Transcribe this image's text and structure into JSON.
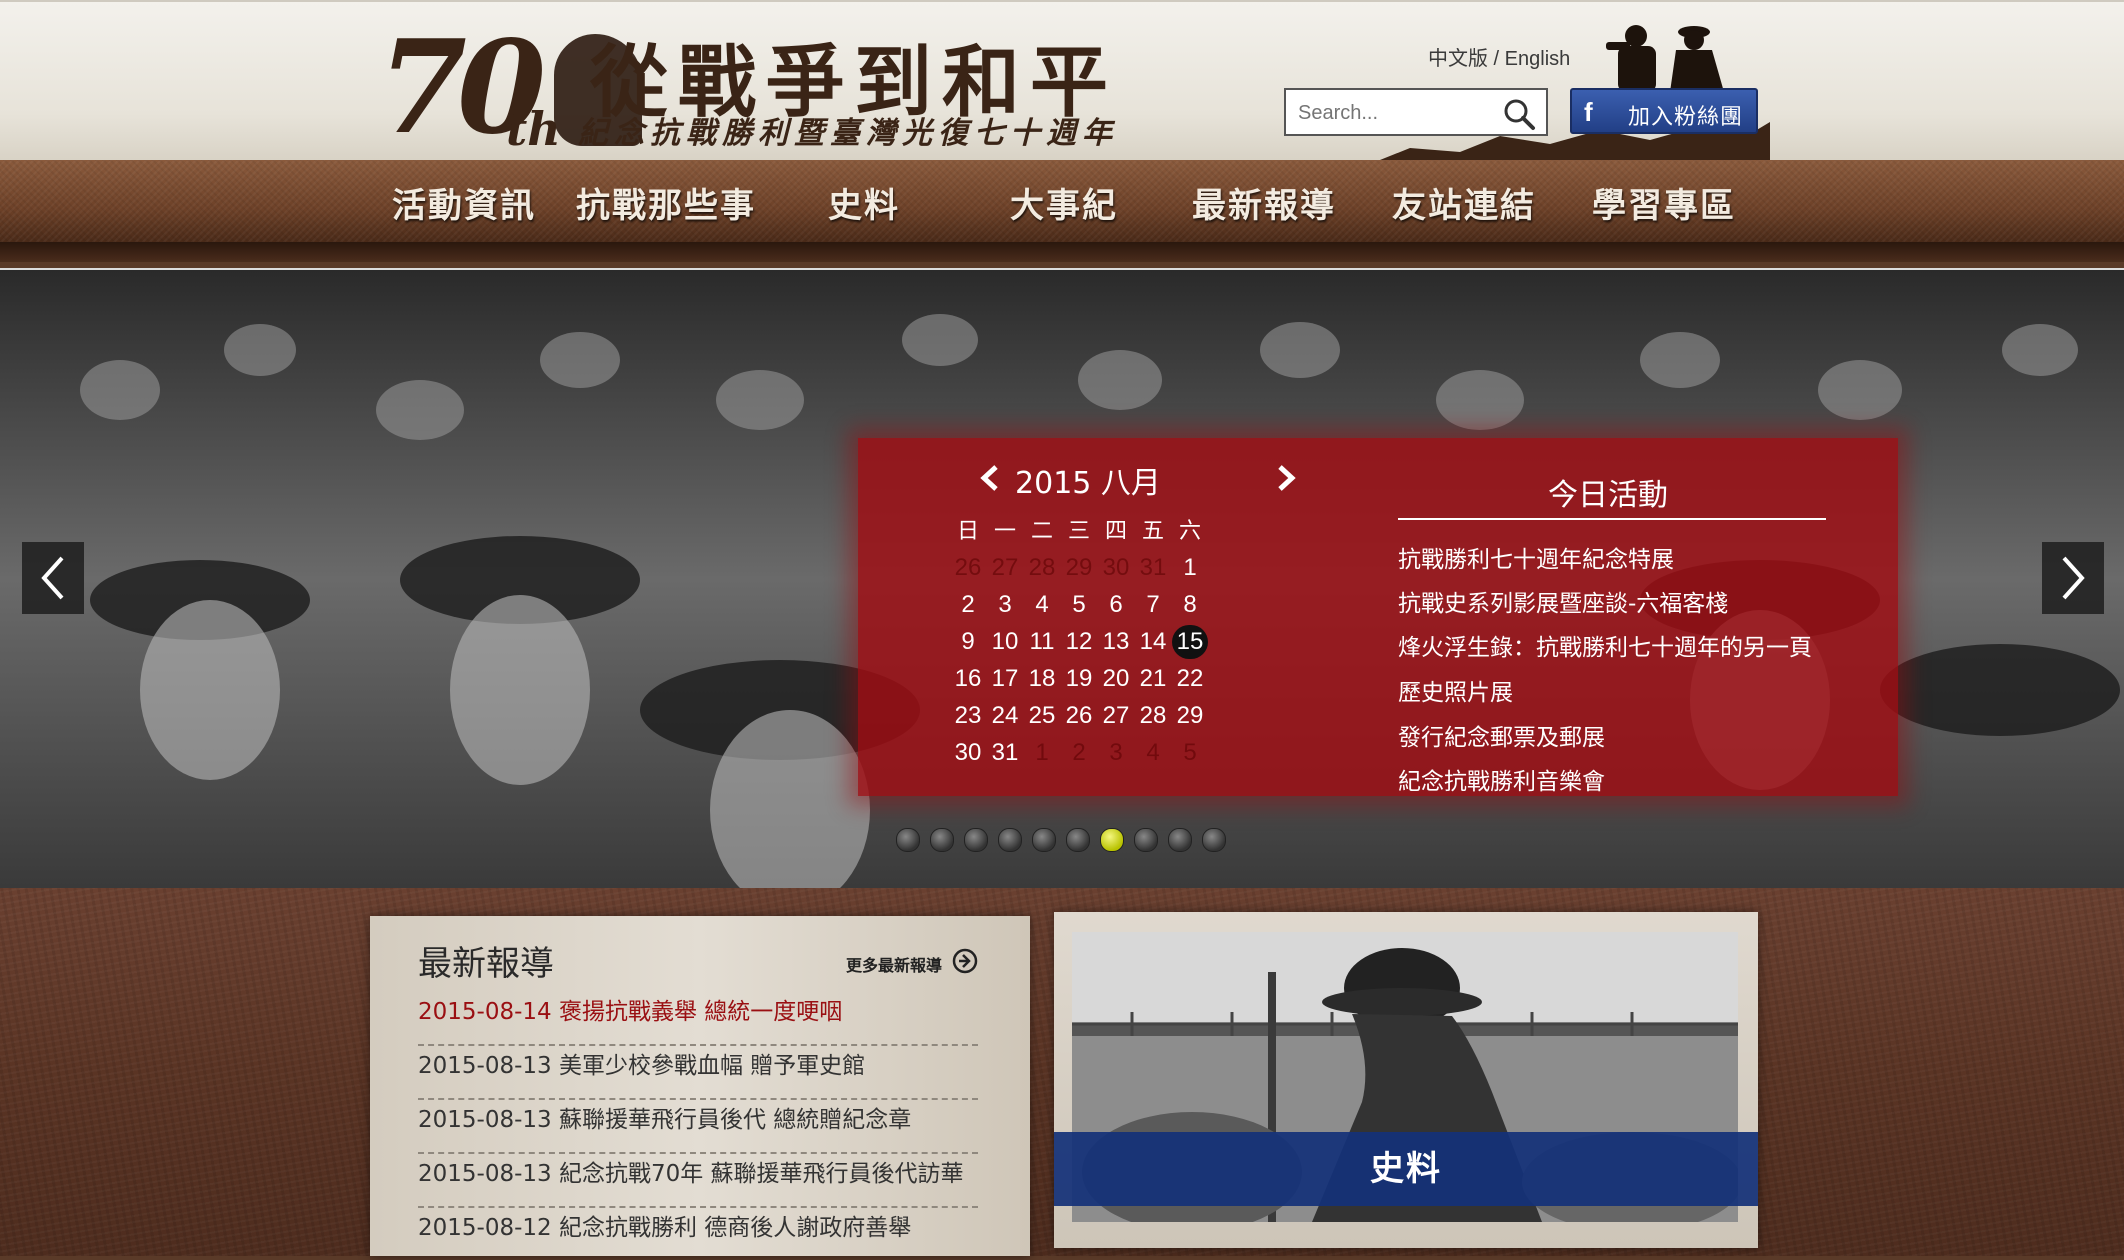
{
  "header": {
    "logo": {
      "number": "70",
      "suffix": "th",
      "title": "從戰爭到和平",
      "subtitle": "紀念抗戰勝利暨臺灣光復七十週年"
    },
    "lang": {
      "zh": "中文版",
      "separator": " / ",
      "en": "English"
    },
    "search": {
      "placeholder": "Search..."
    },
    "facebook": {
      "icon": "f",
      "label": "加入粉絲團"
    }
  },
  "nav": {
    "items": [
      {
        "label": "活動資訊"
      },
      {
        "label": "抗戰那些事"
      },
      {
        "label": "史料"
      },
      {
        "label": "大事紀"
      },
      {
        "label": "最新報導"
      },
      {
        "label": "友站連結"
      },
      {
        "label": "學習專區"
      }
    ]
  },
  "hero": {
    "calendar": {
      "title": "2015 八月",
      "weekdays": [
        "日",
        "一",
        "二",
        "三",
        "四",
        "五",
        "六"
      ],
      "weeks": [
        [
          "26",
          "27",
          "28",
          "29",
          "30",
          "31",
          "1"
        ],
        [
          "2",
          "3",
          "4",
          "5",
          "6",
          "7",
          "8"
        ],
        [
          "9",
          "10",
          "11",
          "12",
          "13",
          "14",
          "15"
        ],
        [
          "16",
          "17",
          "18",
          "19",
          "20",
          "21",
          "22"
        ],
        [
          "23",
          "24",
          "25",
          "26",
          "27",
          "28",
          "29"
        ],
        [
          "30",
          "31",
          "1",
          "2",
          "3",
          "4",
          "5"
        ]
      ],
      "today": "15"
    },
    "activities": {
      "title": "今日活動",
      "items": [
        "抗戰勝利七十週年紀念特展",
        "抗戰史系列影展暨座談-六福客棧",
        "烽火浮生錄：抗戰勝利七十週年的另一頁",
        "歷史照片展",
        "發行紀念郵票及郵展",
        "紀念抗戰勝利音樂會"
      ]
    },
    "slides": {
      "count": 10,
      "active_index": 6
    }
  },
  "news": {
    "title": "最新報導",
    "more": "更多最新報導",
    "items": [
      "2015-08-14 褒揚抗戰義舉 總統一度哽咽",
      "2015-08-13 美軍少校參戰血幅 贈予軍史館",
      "2015-08-13 蘇聯援華飛行員後代 總統贈紀念章",
      "2015-08-13 紀念抗戰70年 蘇聯援華飛行員後代訪華",
      "2015-08-12 紀念抗戰勝利 德商後人謝政府善舉"
    ]
  },
  "history": {
    "label": "史料"
  },
  "colors": {
    "accent_red": "#a00c12",
    "nav_brown": "#6d4128",
    "banner_blue": "#14327a",
    "active_dot": "#d8e000"
  }
}
